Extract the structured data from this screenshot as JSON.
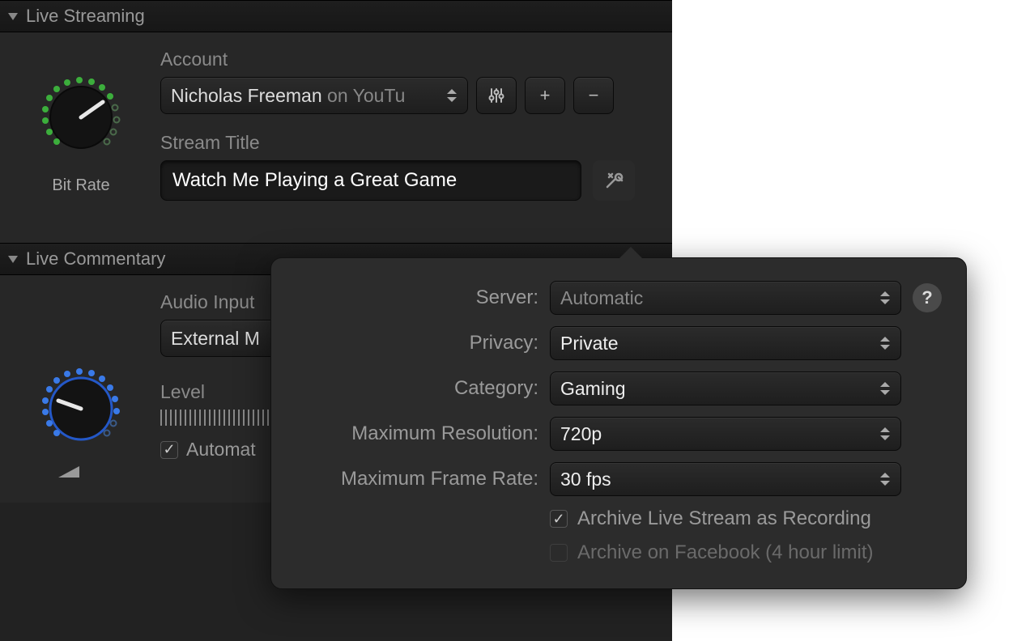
{
  "live_streaming": {
    "header": "Live Streaming",
    "bit_rate_label": "Bit Rate",
    "account": {
      "label": "Account",
      "user": "Nicholas Freeman",
      "suffix": " on YouTu",
      "settings_icon": "sliders",
      "add_label": "+",
      "remove_label": "−"
    },
    "stream_title": {
      "label": "Stream Title",
      "value": "Watch Me Playing a Great Game"
    }
  },
  "live_commentary": {
    "header": "Live Commentary",
    "audio_input": {
      "label": "Audio Input",
      "value": "External M"
    },
    "level_label": "Level",
    "automatic_label": "Automat"
  },
  "popover": {
    "server": {
      "label": "Server:",
      "value": "Automatic"
    },
    "privacy": {
      "label": "Privacy:",
      "value": "Private"
    },
    "category": {
      "label": "Category:",
      "value": "Gaming"
    },
    "max_resolution": {
      "label": "Maximum Resolution:",
      "value": "720p"
    },
    "max_framerate": {
      "label": "Maximum Frame Rate:",
      "value": "30 fps"
    },
    "archive": {
      "label": "Archive Live Stream as Recording",
      "checked": true
    },
    "archive_fb": {
      "label": "Archive on Facebook (4 hour limit)",
      "checked": false,
      "disabled": true
    },
    "help": "?"
  }
}
